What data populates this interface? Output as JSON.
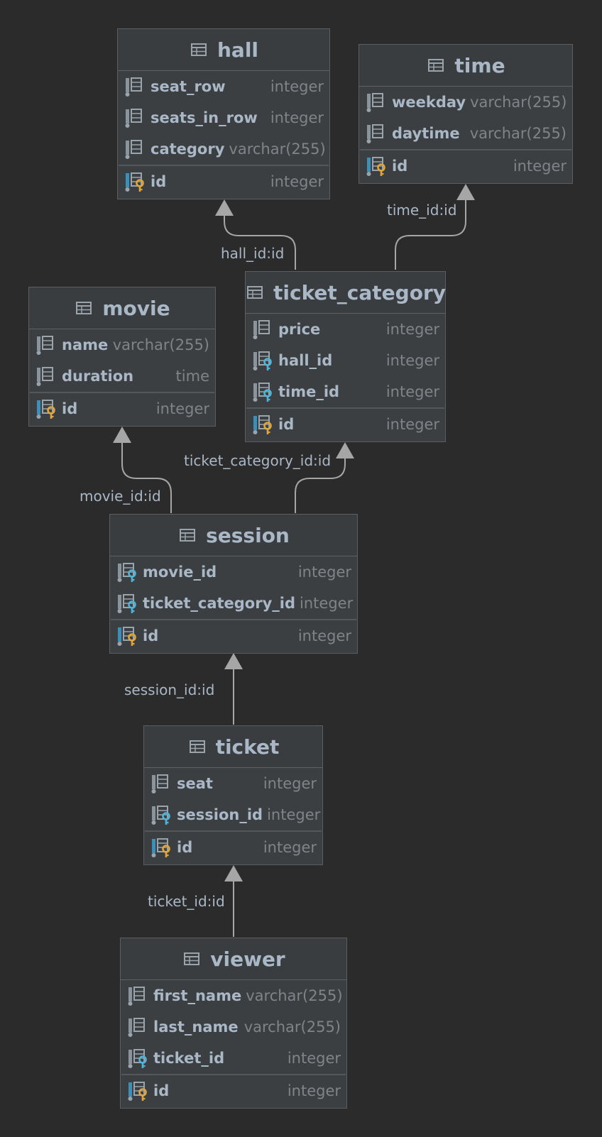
{
  "tables": [
    {
      "id": "hall",
      "name": "hall",
      "columns": [
        {
          "name": "seat_row",
          "type": "integer",
          "kind": "column"
        },
        {
          "name": "seats_in_row",
          "type": "integer",
          "kind": "column"
        },
        {
          "name": "category",
          "type": "varchar(255)",
          "kind": "column"
        }
      ],
      "keys": [
        {
          "name": "id",
          "type": "integer",
          "kind": "pk"
        }
      ]
    },
    {
      "id": "time",
      "name": "time",
      "columns": [
        {
          "name": "weekday",
          "type": "varchar(255)",
          "kind": "column"
        },
        {
          "name": "daytime",
          "type": "varchar(255)",
          "kind": "column"
        }
      ],
      "keys": [
        {
          "name": "id",
          "type": "integer",
          "kind": "pk"
        }
      ]
    },
    {
      "id": "movie",
      "name": "movie",
      "columns": [
        {
          "name": "name",
          "type": "varchar(255)",
          "kind": "column"
        },
        {
          "name": "duration",
          "type": "time",
          "kind": "column"
        }
      ],
      "keys": [
        {
          "name": "id",
          "type": "integer",
          "kind": "pk"
        }
      ]
    },
    {
      "id": "ticket_category",
      "name": "ticket_category",
      "columns": [
        {
          "name": "price",
          "type": "integer",
          "kind": "column"
        },
        {
          "name": "hall_id",
          "type": "integer",
          "kind": "fk"
        },
        {
          "name": "time_id",
          "type": "integer",
          "kind": "fk"
        }
      ],
      "keys": [
        {
          "name": "id",
          "type": "integer",
          "kind": "pk"
        }
      ]
    },
    {
      "id": "session",
      "name": "session",
      "columns": [
        {
          "name": "movie_id",
          "type": "integer",
          "kind": "fk"
        },
        {
          "name": "ticket_category_id",
          "type": "integer",
          "kind": "fk"
        }
      ],
      "keys": [
        {
          "name": "id",
          "type": "integer",
          "kind": "pk"
        }
      ]
    },
    {
      "id": "ticket",
      "name": "ticket",
      "columns": [
        {
          "name": "seat",
          "type": "integer",
          "kind": "column"
        },
        {
          "name": "session_id",
          "type": "integer",
          "kind": "fk"
        }
      ],
      "keys": [
        {
          "name": "id",
          "type": "integer",
          "kind": "pk"
        }
      ]
    },
    {
      "id": "viewer",
      "name": "viewer",
      "columns": [
        {
          "name": "first_name",
          "type": "varchar(255)",
          "kind": "column"
        },
        {
          "name": "last_name",
          "type": "varchar(255)",
          "kind": "column"
        },
        {
          "name": "ticket_id",
          "type": "integer",
          "kind": "fk"
        }
      ],
      "keys": [
        {
          "name": "id",
          "type": "integer",
          "kind": "pk"
        }
      ]
    }
  ],
  "relations": [
    {
      "id": "hall_id",
      "label": "hall_id:id",
      "from": "ticket_category",
      "to": "hall"
    },
    {
      "id": "time_id",
      "label": "time_id:id",
      "from": "ticket_category",
      "to": "time"
    },
    {
      "id": "movie_id",
      "label": "movie_id:id",
      "from": "session",
      "to": "movie"
    },
    {
      "id": "ticket_category_id",
      "label": "ticket_category_id:id",
      "from": "session",
      "to": "ticket_category"
    },
    {
      "id": "session_id",
      "label": "session_id:id",
      "from": "ticket",
      "to": "session"
    },
    {
      "id": "ticket_id",
      "label": "ticket_id:id",
      "from": "viewer",
      "to": "ticket"
    }
  ],
  "icons": {
    "table": "table-icon",
    "column": "column-icon",
    "fk": "foreign-key-column-icon",
    "pk": "primary-key-column-icon"
  },
  "colors": {
    "background": "#2b2b2b",
    "table_bg": "#3c3f41",
    "text": "#a9b7c6",
    "type_text": "#7f848a",
    "fk_key": "#4fb4d8",
    "pk_key": "#e2a53a",
    "edge": "#a6a6a6"
  }
}
